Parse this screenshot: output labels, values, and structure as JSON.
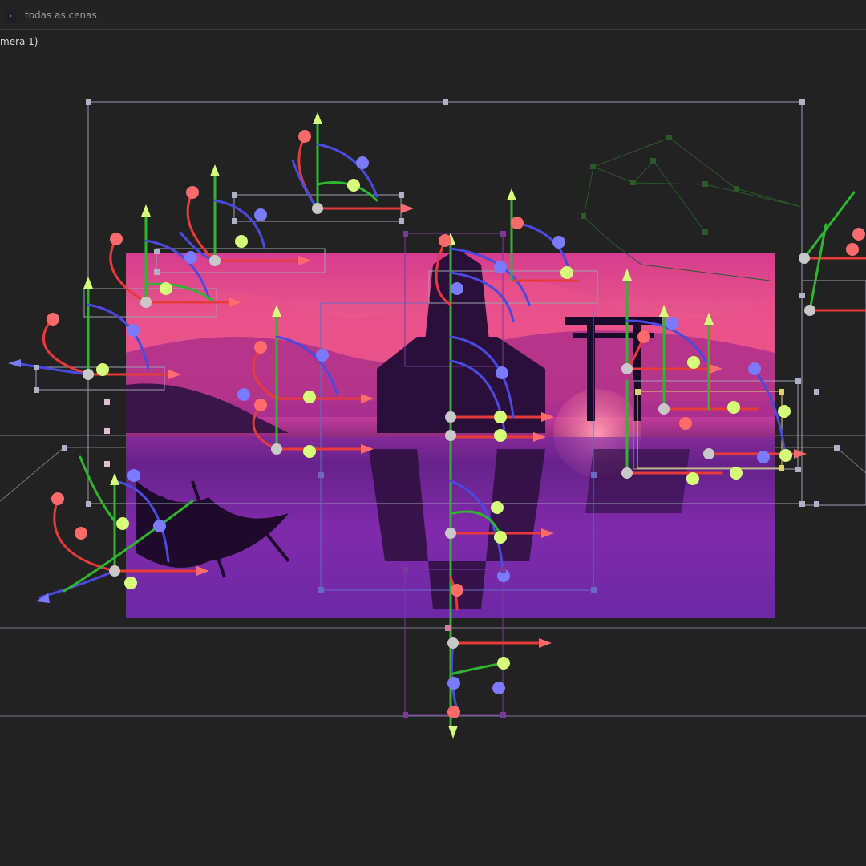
{
  "header": {
    "expand_icon": "chevron-right-icon",
    "scope_label": "todas as cenas"
  },
  "viewport": {
    "title": "mera 1)"
  },
  "colors": {
    "x_axis": "#e83a3a",
    "y_axis": "#2fb52f",
    "z_axis": "#4a4ae0",
    "handle_red": "#ff6b6b",
    "handle_green": "#d6ff7a",
    "handle_blue": "#7a7aff",
    "pivot": "#c8c8c8"
  }
}
